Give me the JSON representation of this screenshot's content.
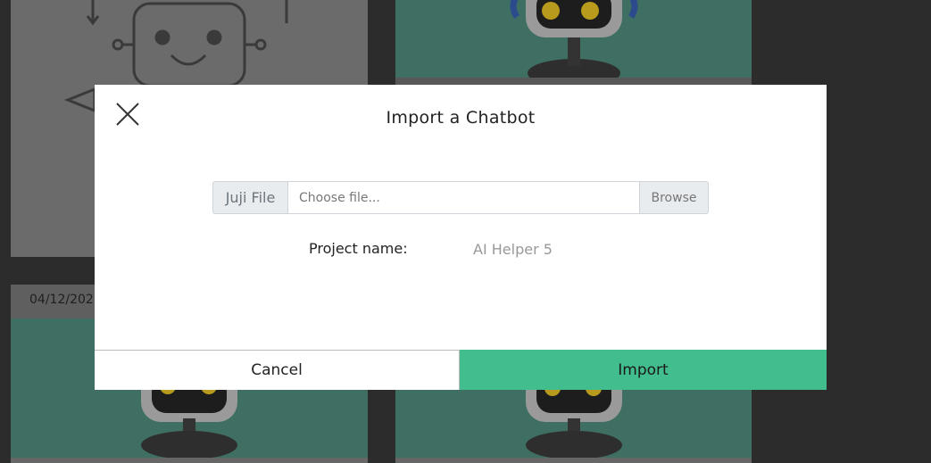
{
  "background": {
    "cards": [
      {
        "date": ""
      },
      {
        "date": ""
      },
      {
        "date": "04/12/202"
      },
      {
        "date": ""
      }
    ]
  },
  "modal": {
    "title": "Import a Chatbot",
    "close_icon": "close-icon",
    "file_label": "Juji File",
    "file_placeholder": "Choose file...",
    "browse_label": "Browse",
    "project_label": "Project name:",
    "project_value": "AI Helper 5",
    "cancel_label": "Cancel",
    "import_label": "Import"
  },
  "colors": {
    "accent": "#42bd8d",
    "card_teal": "#3f6e62",
    "backdrop": "#2c2c2c"
  }
}
